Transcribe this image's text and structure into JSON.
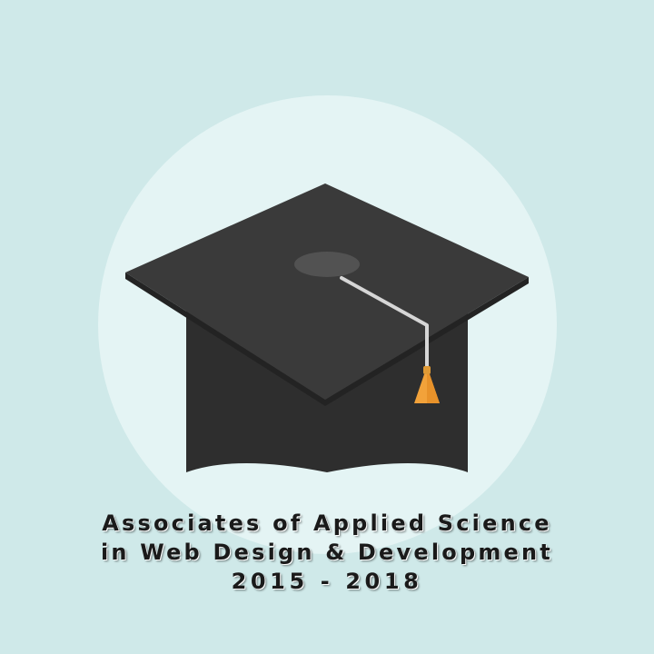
{
  "colors": {
    "background": "#cfe9e9",
    "circle": "#e4f4f4",
    "cap_body": "#2f2f2f",
    "cap_board": "#3a3a3a",
    "cap_button": "#4a4a4a",
    "tassel_cord": "#d8d8d8",
    "tassel": "#f2a23a"
  },
  "icons": {
    "main": "graduation-cap-icon",
    "tassel": "tassel-icon"
  },
  "caption": {
    "line1": "Associates of Applied Science",
    "line2": "in Web Design & Development",
    "line3": "2015 - 2018"
  }
}
